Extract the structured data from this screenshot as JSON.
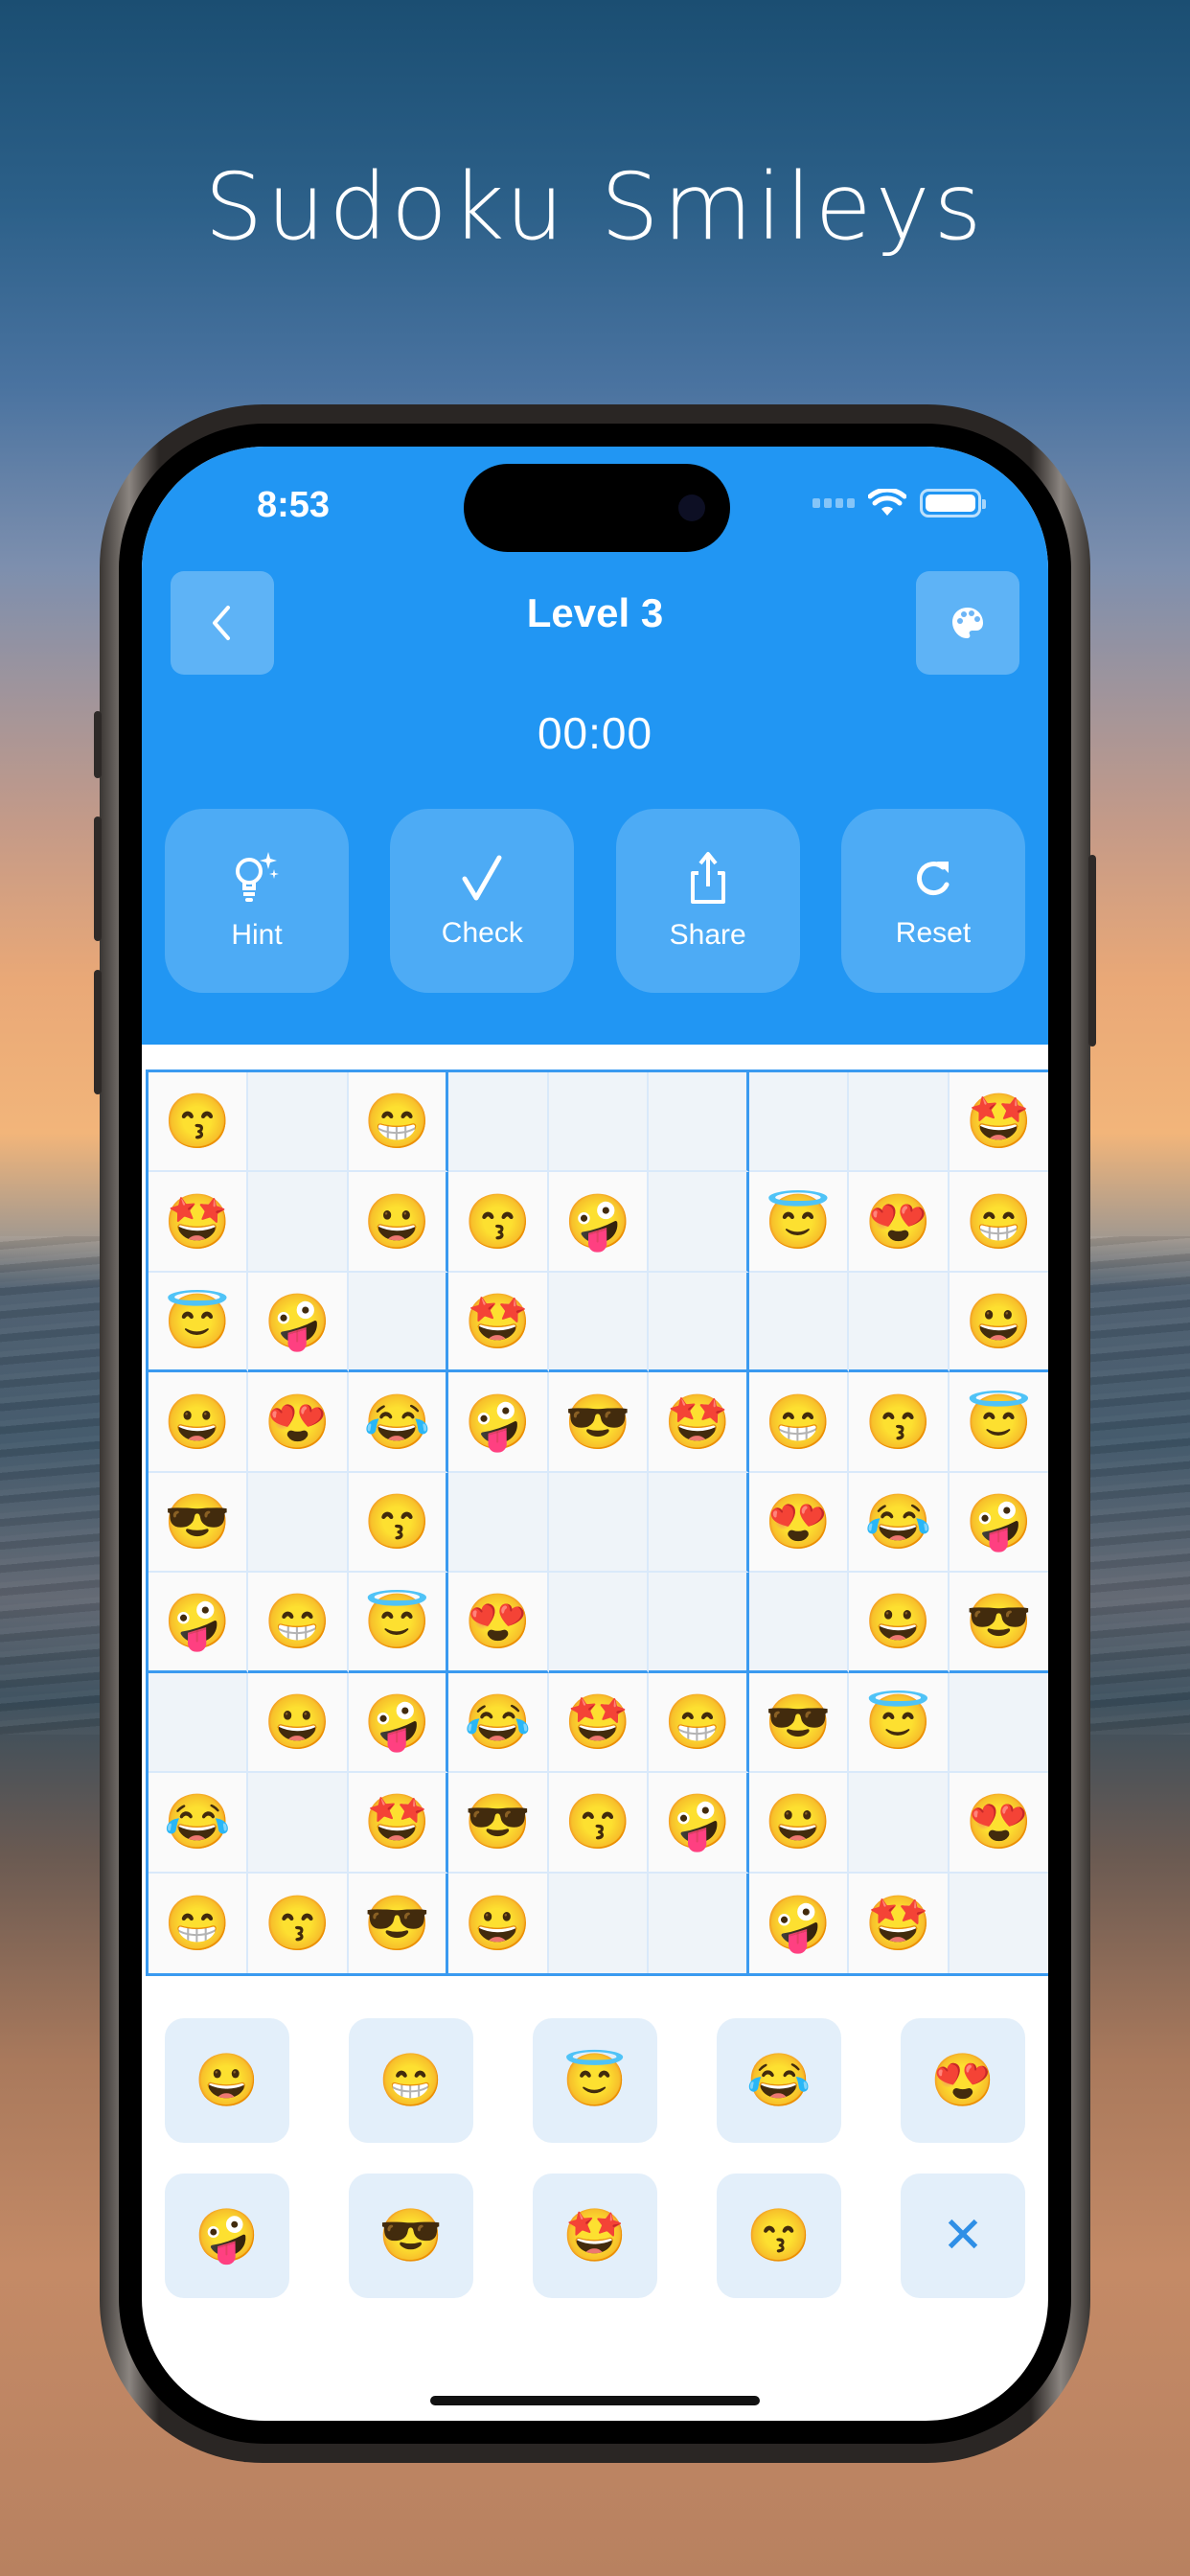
{
  "headline": "Sudoku Smileys",
  "status_bar": {
    "time": "8:53"
  },
  "header": {
    "title": "Level 3",
    "timer": "00:00",
    "back_icon": "chevron-left-icon",
    "theme_icon": "palette-icon"
  },
  "actions": [
    {
      "label": "Hint",
      "icon": "lightbulb-sparkle-icon"
    },
    {
      "label": "Check",
      "icon": "checkmark-icon"
    },
    {
      "label": "Share",
      "icon": "share-icon"
    },
    {
      "label": "Reset",
      "icon": "refresh-icon"
    }
  ],
  "colors": {
    "primary": "#2196f3",
    "board_border": "#3a9af0",
    "empty_cell": "#eff4f9",
    "key_bg": "#e3effa"
  },
  "board": [
    [
      "😙",
      "",
      "😁",
      "",
      "",
      "",
      "",
      "",
      "🤩"
    ],
    [
      "🤩",
      "",
      "😀",
      "😙",
      "🤪",
      "",
      "😇",
      "😍",
      "😁"
    ],
    [
      "😇",
      "🤪",
      "",
      "🤩",
      "",
      "",
      "",
      "",
      "😀"
    ],
    [
      "😀",
      "😍",
      "😂",
      "🤪",
      "😎",
      "🤩",
      "😁",
      "😙",
      "😇"
    ],
    [
      "😎",
      "",
      "😙",
      "",
      "",
      "",
      "😍",
      "😂",
      "🤪"
    ],
    [
      "🤪",
      "😁",
      "😇",
      "😍",
      "",
      "",
      "",
      "😀",
      "😎"
    ],
    [
      "",
      "😀",
      "🤪",
      "😂",
      "🤩",
      "😁",
      "😎",
      "😇",
      ""
    ],
    [
      "😂",
      "",
      "🤩",
      "😎",
      "😙",
      "🤪",
      "😀",
      "",
      "😍"
    ],
    [
      "😁",
      "😙",
      "😎",
      "😀",
      "",
      "",
      "🤪",
      "🤩",
      ""
    ]
  ],
  "keypad": [
    {
      "value": "😀",
      "name": "grinning"
    },
    {
      "value": "😁",
      "name": "beaming"
    },
    {
      "value": "😇",
      "name": "halo"
    },
    {
      "value": "😂",
      "name": "tears-of-joy"
    },
    {
      "value": "😍",
      "name": "heart-eyes"
    },
    {
      "value": "🤪",
      "name": "zany"
    },
    {
      "value": "😎",
      "name": "sunglasses"
    },
    {
      "value": "🤩",
      "name": "star-struck"
    },
    {
      "value": "😙",
      "name": "kissing"
    },
    {
      "value": "✕",
      "name": "clear"
    }
  ]
}
